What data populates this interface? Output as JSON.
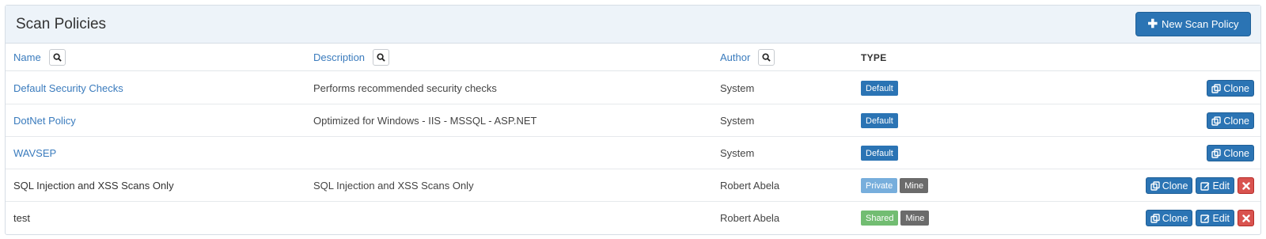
{
  "panel": {
    "title": "Scan Policies",
    "new_button": "New Scan Policy"
  },
  "columns": {
    "name": "Name",
    "description": "Description",
    "author": "Author",
    "type": "TYPE"
  },
  "rows": [
    {
      "name": "Default Security Checks",
      "description": "Performs recommended security checks",
      "author": "System",
      "badges": [
        "Default"
      ],
      "actions": [
        "Clone"
      ]
    },
    {
      "name": "DotNet Policy",
      "description": "Optimized for Windows - IIS - MSSQL - ASP.NET",
      "author": "System",
      "badges": [
        "Default"
      ],
      "actions": [
        "Clone"
      ]
    },
    {
      "name": "WAVSEP",
      "description": "",
      "author": "System",
      "badges": [
        "Default"
      ],
      "actions": [
        "Clone"
      ]
    },
    {
      "name": "SQL Injection and XSS Scans Only",
      "description": "SQL Injection and XSS Scans Only",
      "author": "Robert Abela",
      "badges": [
        "Private",
        "Mine"
      ],
      "actions": [
        "Clone",
        "Edit"
      ]
    },
    {
      "name": "test",
      "description": "",
      "author": "Robert Abela",
      "badges": [
        "Shared",
        "Mine"
      ],
      "actions": [
        "Clone",
        "Edit"
      ]
    }
  ],
  "colors": {
    "primary": "#2b74b4",
    "link": "#3a7bbd",
    "private": "#77aedc",
    "shared": "#72bd72",
    "mine": "#6b6b6b",
    "danger": "#d9534f",
    "header_bg": "#edf3f9"
  },
  "icons": {
    "new": "plus-icon",
    "search": "search-icon",
    "clone": "clone-icon",
    "edit": "edit-icon",
    "delete": "close-icon"
  }
}
